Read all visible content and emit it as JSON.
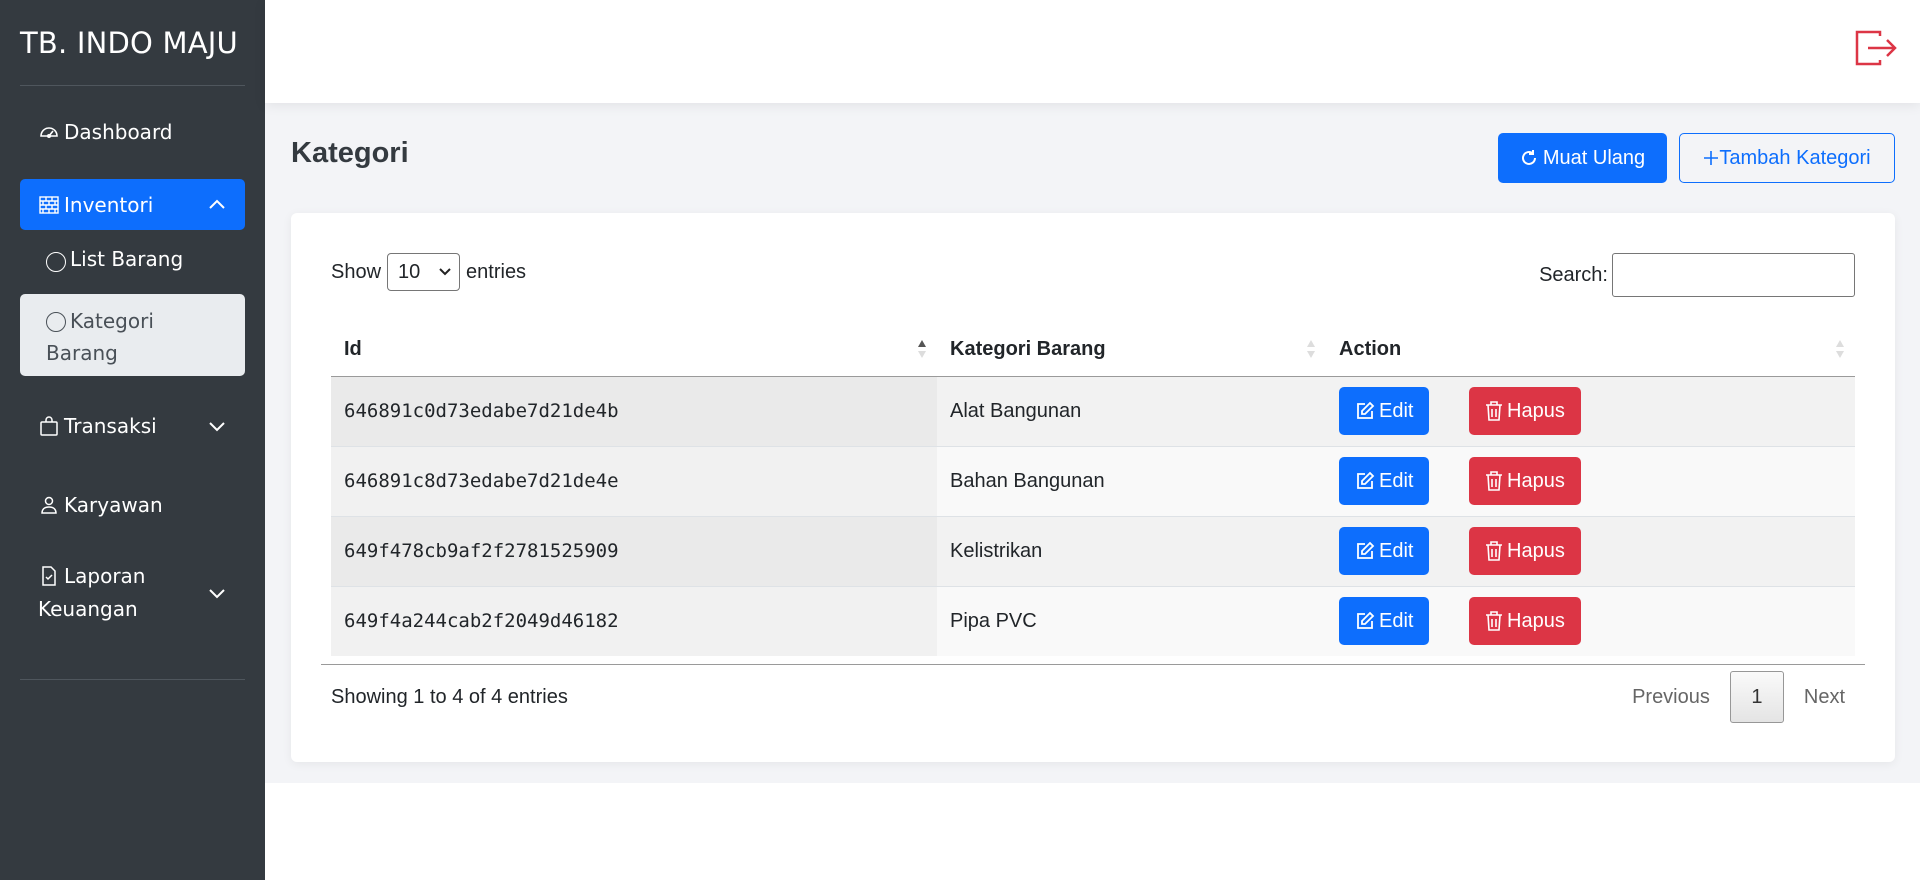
{
  "app": {
    "brand": "TB. INDO MAJU"
  },
  "sidebar": {
    "items": [
      {
        "label": "Dashboard",
        "icon": "speedometer-icon"
      },
      {
        "label": "Inventori",
        "icon": "bricks-icon",
        "expanded": true,
        "children": [
          {
            "label": "List Barang"
          },
          {
            "label": "Kategori Barang",
            "active": true
          }
        ]
      },
      {
        "label": "Transaksi",
        "icon": "bag-icon"
      },
      {
        "label": "Karyawan",
        "icon": "person-icon"
      },
      {
        "label": "Laporan Keuangan",
        "icon": "file-check-icon"
      }
    ],
    "kategori_line1": "Kategori",
    "kategori_line2": "Barang",
    "laporan_line1": "Laporan",
    "laporan_line2": "Keuangan"
  },
  "page": {
    "title": "Kategori",
    "reload_label": "Muat Ulang",
    "add_label": "Tambah Kategori"
  },
  "table_controls": {
    "show_label": "Show",
    "page_size": "10",
    "entries_label": "entries",
    "search_label": "Search:"
  },
  "table": {
    "columns": [
      "Id",
      "Kategori Barang",
      "Action"
    ],
    "rows": [
      {
        "id": "646891c0d73edabe7d21de4b",
        "kategori": "Alat Bangunan"
      },
      {
        "id": "646891c8d73edabe7d21de4e",
        "kategori": "Bahan Bangunan"
      },
      {
        "id": "649f478cb9af2f2781525909",
        "kategori": "Kelistrikan"
      },
      {
        "id": "649f4a244cab2f2049d46182",
        "kategori": "Pipa PVC"
      }
    ],
    "edit_label": "Edit",
    "delete_label": "Hapus"
  },
  "footer": {
    "info": "Showing 1 to 4 of 4 entries",
    "previous": "Previous",
    "current_page": "1",
    "next": "Next"
  },
  "colors": {
    "sidebar_bg": "#343a40",
    "primary": "#0d6efd",
    "danger": "#dc3545",
    "logout_icon": "#dc3545"
  }
}
